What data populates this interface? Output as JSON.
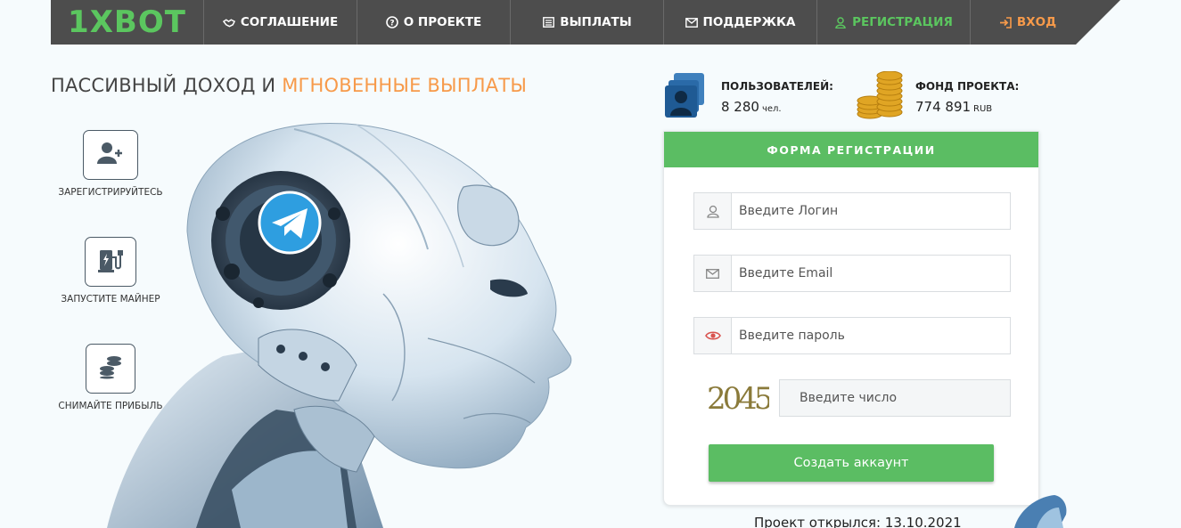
{
  "nav": {
    "logo": "1XBOT",
    "items": [
      {
        "label": "СОГЛАШЕНИЕ",
        "icon": "handshake-icon"
      },
      {
        "label": "О ПРОЕКТЕ",
        "icon": "question-circle-icon"
      },
      {
        "label": "ВЫПЛАТЫ",
        "icon": "list-icon"
      },
      {
        "label": "ПОДДЕРЖКА",
        "icon": "envelope-icon"
      },
      {
        "label": "РЕГИСТРАЦИЯ",
        "icon": "user-icon"
      },
      {
        "label": "ВХОД",
        "icon": "sign-in-icon"
      }
    ]
  },
  "hero": {
    "headline_main": "ПАССИВНЫЙ ДОХОД И ",
    "headline_accent": "МГНОВЕННЫЕ ВЫПЛАТЫ"
  },
  "steps": [
    {
      "label": "ЗАРЕГИСТРИРУЙТЕСЬ",
      "icon": "user-add-icon"
    },
    {
      "label": "ЗАПУСТИТЕ МАЙНЕР",
      "icon": "charging-station-icon"
    },
    {
      "label": "СНИМАЙТЕ ПРИБЫЛЬ",
      "icon": "coins-stack-icon"
    }
  ],
  "stats": {
    "users_title": "ПОЛЬЗОВАТЕЛЕЙ:",
    "users_value": "8 280",
    "users_unit": "чел.",
    "fund_title": "ФОНД ПРОЕКТА:",
    "fund_value": "774 891",
    "fund_unit": "RUB"
  },
  "form": {
    "title": "ФОРМА РЕГИСТРАЦИИ",
    "login_placeholder": "Введите Логин",
    "email_placeholder": "Введите Email",
    "password_placeholder": "Введите пароль",
    "captcha_code": "2045",
    "captcha_placeholder": "Введите число",
    "submit_label": "Создать аккаунт"
  },
  "footer": {
    "opened_text": "Проект открылся: 13.10.2021"
  },
  "colors": {
    "accent_green": "#5bbd63",
    "accent_orange": "#f79a4a",
    "nav_dark": "#4d4d4d",
    "telegram_blue": "#2e9ee0"
  }
}
